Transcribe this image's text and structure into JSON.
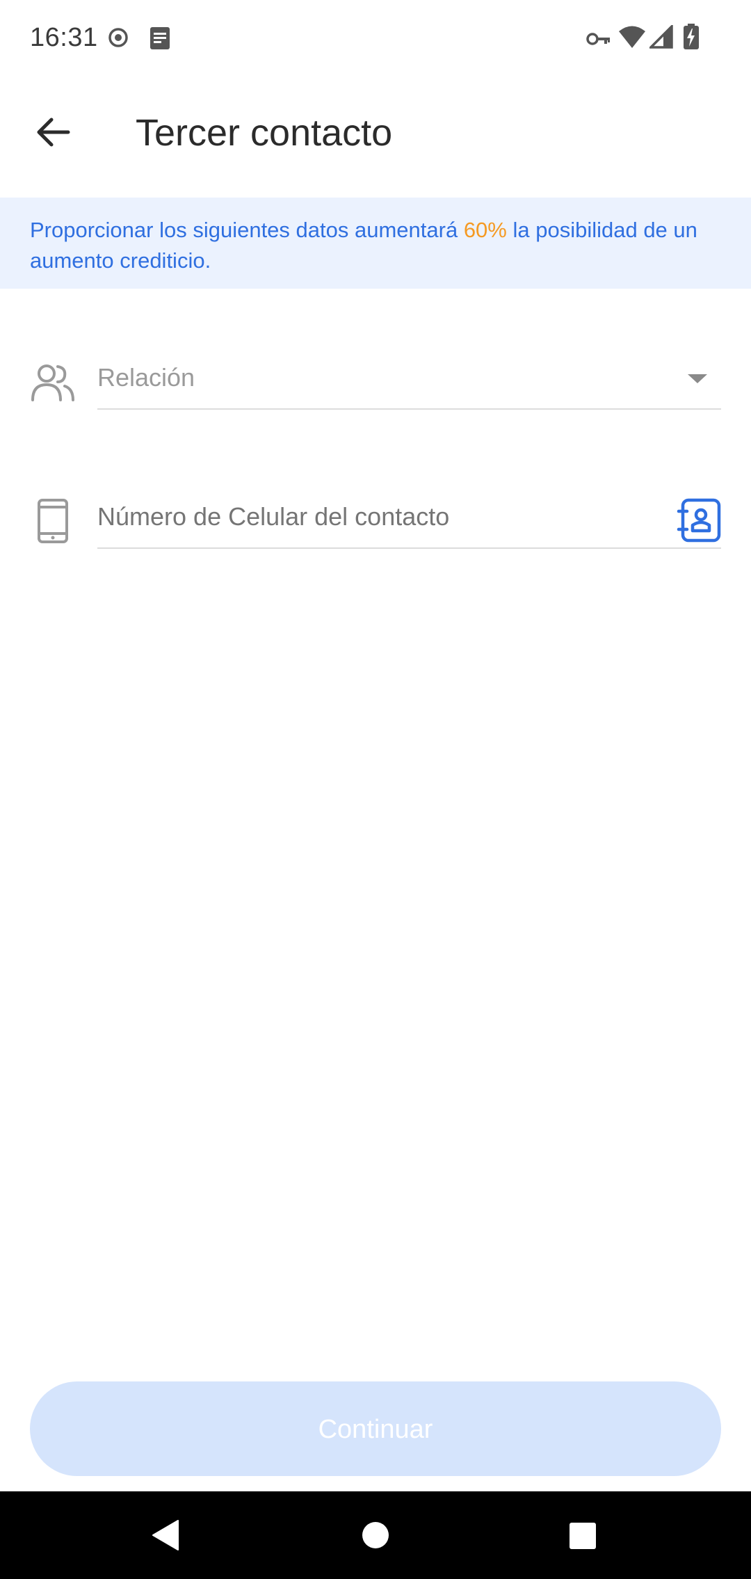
{
  "status_bar": {
    "time": "16:31",
    "icons": [
      "record-icon",
      "notes-icon",
      "vpn-key-icon",
      "wifi-icon",
      "signal-icon",
      "battery-charging-icon"
    ]
  },
  "app_bar": {
    "back_icon": "arrow-left-icon",
    "title": "Tercer contacto"
  },
  "info_banner": {
    "text_before": "Proporcionar los siguientes datos aumentará ",
    "highlight": "60%",
    "text_after": " la posibilidad de un aumento crediticio.",
    "text_color": "#2f6fe0",
    "highlight_color": "#f59a23",
    "background": "#ebf2fe"
  },
  "form": {
    "relation": {
      "icon": "people-icon",
      "placeholder": "Relación",
      "value": ""
    },
    "phone": {
      "icon": "mobile-phone-icon",
      "placeholder": "Número de Celular del contacto",
      "value": "",
      "action_icon": "contacts-book-icon"
    }
  },
  "continue_button": {
    "label": "Continuar",
    "enabled": false,
    "color": "#d5e4fc"
  },
  "nav_bar": {
    "buttons": [
      "back-triangle-icon",
      "home-circle-icon",
      "recents-square-icon"
    ]
  },
  "colors": {
    "accent": "#2f6fe0",
    "highlight": "#f59a23"
  }
}
